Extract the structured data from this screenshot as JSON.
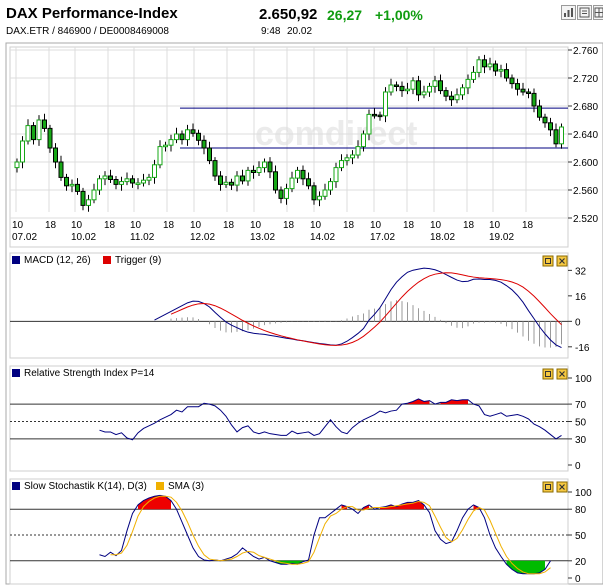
{
  "header": {
    "title": "DAX Performance-Index",
    "price": "2.650,92",
    "change": "26,27",
    "change_pct": "+1,00%",
    "identifiers": "DAX.ETR  /  846900  /  DE0008469008",
    "time": "9:48",
    "date": "20.02"
  },
  "colors": {
    "positive": "#109c10",
    "candle": "#16a816",
    "macd": "#000080",
    "trigger": "#dd0000",
    "rsi": "#000080",
    "stoch_k": "#000080",
    "stoch_d": "#f0b000",
    "fill_high": "#ee0000",
    "fill_low": "#00bb00",
    "grid": "#dcdcdc",
    "hline": "#000080"
  },
  "watermark": "comdirect",
  "toolbar_icons": [
    "bar-chart-icon",
    "news-icon",
    "grid-icon"
  ],
  "chart_data": [
    {
      "type": "candlestick",
      "title": "DAX Performance-Index",
      "x_major": [
        "07.02",
        "10.02",
        "11.02",
        "12.02",
        "13.02",
        "14.02",
        "17.02",
        "18.02",
        "19.02"
      ],
      "x_minor": [
        "10",
        "18"
      ],
      "yticks": [
        "2.760",
        "2.720",
        "2.680",
        "2.640",
        "2.600",
        "2.560",
        "2.520"
      ],
      "ylim": [
        2520,
        2760
      ],
      "hlines": [
        2677,
        2620
      ],
      "closes": [
        2600,
        2630,
        2652,
        2632,
        2660,
        2648,
        2620,
        2600,
        2578,
        2566,
        2568,
        2558,
        2538,
        2546,
        2560,
        2576,
        2580,
        2575,
        2568,
        2572,
        2576,
        2570,
        2570,
        2574,
        2578,
        2596,
        2622,
        2624,
        2632,
        2640,
        2632,
        2646,
        2641,
        2631,
        2620,
        2602,
        2580,
        2568,
        2571,
        2567,
        2580,
        2573,
        2588,
        2585,
        2592,
        2600,
        2586,
        2560,
        2548,
        2562,
        2577,
        2588,
        2576,
        2566,
        2546,
        2551,
        2560,
        2572,
        2592,
        2602,
        2606,
        2610,
        2622,
        2640,
        2668,
        2667,
        2666,
        2700,
        2710,
        2708,
        2702,
        2704,
        2716,
        2696,
        2700,
        2708,
        2716,
        2702,
        2694,
        2689,
        2696,
        2706,
        2718,
        2728,
        2746,
        2736,
        2740,
        2730,
        2732,
        2720,
        2712,
        2704,
        2700,
        2698,
        2680,
        2664,
        2656,
        2646,
        2626,
        2650
      ],
      "series": [
        {
          "name": "DAX Performance-Index"
        }
      ]
    },
    {
      "type": "line",
      "title": "MACD (12, 26)",
      "series": [
        {
          "name": "MACD (12, 26)",
          "values": [
            null,
            null,
            null,
            null,
            null,
            null,
            null,
            null,
            null,
            null,
            null,
            null,
            null,
            null,
            null,
            null,
            null,
            null,
            null,
            null,
            null,
            null,
            null,
            null,
            null,
            0.8,
            2.6,
            4.4,
            6.2,
            8,
            9.8,
            11.6,
            12.7,
            12.5,
            11.2,
            9,
            5.6,
            2.5,
            -0.4,
            -2.4,
            -4,
            -5.6,
            -6.8,
            -7.5,
            -7.9,
            -8.2,
            -8.8,
            -9.4,
            -10,
            -10.6,
            -11.1,
            -11.8,
            -12.2,
            -12.8,
            -13.4,
            -13.9,
            -14.3,
            -14.8,
            -15,
            -14.2,
            -12.5,
            -10.2,
            -7.6,
            -4.5,
            0.7,
            4.4,
            8.6,
            14.2,
            19.9,
            24.6,
            28,
            30.8,
            32.1,
            32.8,
            33.4,
            33.1,
            32.4,
            31.1,
            29.4,
            27.6,
            25.9,
            24.9,
            25.2,
            26.4,
            26.6,
            26.3,
            26.3,
            25.7,
            24.6,
            22.4,
            19.8,
            16.3,
            12,
            6.7,
            1.7,
            -3.4,
            -7.8,
            -11.7,
            -14.8,
            -16.5
          ]
        },
        {
          "name": "Trigger (9)",
          "values": [
            null,
            null,
            null,
            null,
            null,
            null,
            null,
            null,
            null,
            null,
            null,
            null,
            null,
            null,
            null,
            null,
            null,
            null,
            null,
            null,
            null,
            null,
            null,
            null,
            null,
            null,
            null,
            null,
            4.5,
            6,
            7.5,
            9,
            10.2,
            11,
            11.2,
            10.8,
            9.8,
            8.3,
            6.5,
            4.6,
            2.6,
            0.6,
            -1.2,
            -2.9,
            -4.4,
            -5.8,
            -7,
            -8.1,
            -9.1,
            -10,
            -10.8,
            -11.6,
            -12.3,
            -13,
            -13.6,
            -14.2,
            -14.7,
            -15,
            -15.1,
            -14.9,
            -14.3,
            -13.2,
            -11.6,
            -9.4,
            -6.6,
            -3.6,
            -0.4,
            3.4,
            7.4,
            11.4,
            15.3,
            18.8,
            21.9,
            24.6,
            26.8,
            28.5,
            29.6,
            30.2,
            30.5,
            30.4,
            29.9,
            29.2,
            28.4,
            27.8,
            27.4,
            27.1,
            26.9,
            26.6,
            26.2,
            25.6,
            24.7,
            23.4,
            21.5,
            18.9,
            15.8,
            12.3,
            8.6,
            4.8,
            1.3,
            -2.1
          ]
        }
      ],
      "yticks": [
        "32",
        "16",
        "0",
        "-16"
      ],
      "ylim": [
        -18,
        36
      ]
    },
    {
      "type": "line",
      "title": "Relative Strength Index P=14",
      "series": [
        {
          "name": "Relative Strength Index P=14",
          "values": [
            null,
            null,
            null,
            null,
            null,
            null,
            null,
            null,
            null,
            null,
            null,
            null,
            null,
            null,
            null,
            40,
            38,
            38,
            35,
            37,
            31,
            29,
            37,
            42,
            45,
            48,
            52,
            55,
            58,
            63,
            61,
            67,
            67,
            67,
            71,
            70,
            68,
            63,
            56,
            46,
            38,
            43,
            45,
            38,
            36,
            38,
            36,
            35,
            34,
            34,
            39,
            36,
            37,
            38,
            34,
            36,
            44,
            52,
            44,
            38,
            36,
            43,
            48,
            52,
            55,
            58,
            62,
            60,
            62,
            63,
            70,
            71,
            73,
            76,
            73,
            74,
            70,
            72,
            72,
            75,
            74,
            75,
            75,
            70,
            68,
            58,
            56,
            58,
            60,
            56,
            57,
            58,
            56,
            53,
            47,
            44,
            40,
            35,
            30,
            34
          ]
        }
      ],
      "hlines": [
        70,
        50,
        30
      ],
      "yticks": [
        "100",
        "70",
        "50",
        "30",
        "0"
      ],
      "ylim": [
        0,
        100
      ]
    },
    {
      "type": "line",
      "title": "Slow Stochastik K(14), D(3)",
      "series": [
        {
          "name": "Slow Stochastik K(14), D(3)",
          "values": [
            null,
            null,
            null,
            null,
            null,
            null,
            null,
            null,
            null,
            null,
            null,
            null,
            null,
            null,
            null,
            27,
            25,
            30,
            26,
            32,
            55,
            75,
            85,
            90,
            93,
            95,
            96,
            95,
            90,
            80,
            65,
            50,
            35,
            25,
            21,
            20,
            21,
            20,
            22,
            24,
            28,
            35,
            30,
            25,
            22,
            24,
            20,
            18,
            16,
            16,
            17,
            16,
            19,
            21,
            50,
            70,
            70,
            75,
            80,
            85,
            83,
            80,
            75,
            82,
            85,
            80,
            82,
            83,
            85,
            83,
            86,
            88,
            88,
            90,
            85,
            76,
            55,
            45,
            40,
            42,
            55,
            70,
            80,
            85,
            82,
            70,
            50,
            35,
            25,
            16,
            10,
            6,
            5,
            5,
            5,
            6,
            10,
            20
          ]
        },
        {
          "name": "SMA (3)",
          "values": [
            null,
            null,
            null,
            null,
            null,
            null,
            null,
            null,
            null,
            null,
            null,
            null,
            null,
            null,
            null,
            null,
            null,
            27,
            27,
            29,
            38,
            54,
            72,
            83,
            89,
            93,
            95,
            95,
            94,
            88,
            78,
            65,
            50,
            37,
            27,
            22,
            21,
            20,
            21,
            22,
            25,
            29,
            31,
            30,
            26,
            24,
            22,
            20,
            18,
            17,
            16,
            16,
            17,
            19,
            30,
            47,
            63,
            72,
            75,
            80,
            83,
            83,
            79,
            79,
            81,
            82,
            82,
            82,
            83,
            84,
            85,
            86,
            87,
            89,
            88,
            84,
            72,
            59,
            47,
            42,
            46,
            56,
            68,
            78,
            82,
            79,
            67,
            52,
            37,
            25,
            17,
            11,
            7,
            5,
            5,
            5,
            7,
            12
          ]
        }
      ],
      "hlines": [
        80,
        50,
        20
      ],
      "yticks": [
        "100",
        "80",
        "50",
        "20",
        "0"
      ],
      "ylim": [
        0,
        100
      ],
      "legend_values": [
        "SMA (3)"
      ]
    }
  ]
}
